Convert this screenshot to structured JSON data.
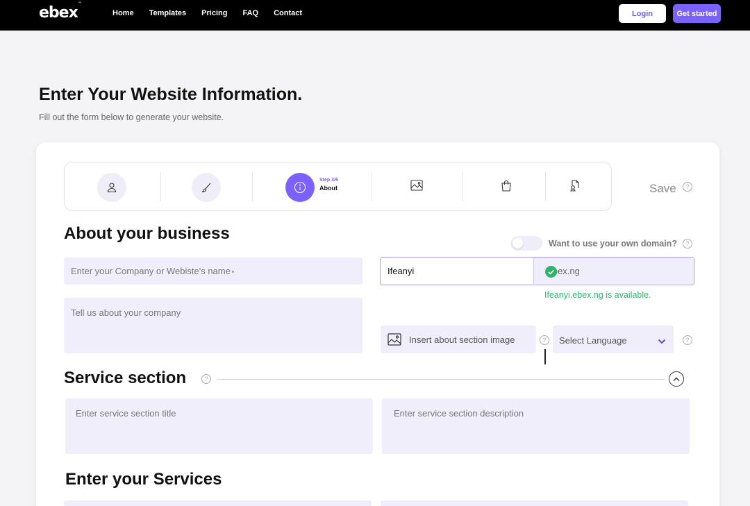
{
  "brand": {
    "name": "ebex",
    "tm": "™"
  },
  "nav": {
    "links": [
      "Home",
      "Templates",
      "Pricing",
      "FAQ",
      "Contact"
    ],
    "login": "Login",
    "get_started": "Get started"
  },
  "header": {
    "title": "Enter Your Website Information.",
    "subtitle": "Fill out the form below  to generate your website."
  },
  "stepper": {
    "step_count": "Step 3/6",
    "step_label": "About",
    "icons": [
      "user-icon",
      "brush-icon",
      "info-icon",
      "image-icon",
      "shopping-bag-icon",
      "document-icon"
    ],
    "save_label": "Save"
  },
  "about": {
    "title": "About your business",
    "domain_question": "Want to use your own domain?",
    "company_placeholder": "Enter your Company or Webiste's name",
    "about_placeholder": "Tell us about your company",
    "domain_value": "Ifeanyi",
    "domain_suffix": ".ebex.ng",
    "availability": "Ifeanyi.ebex.ng is available.",
    "image_label": "Insert about section image",
    "language_label": "Select Language"
  },
  "service": {
    "title": "Service section",
    "title_placeholder": "Enter service section title",
    "desc_placeholder": "Enter service section description"
  },
  "services": {
    "title": "Enter your Services"
  },
  "colors": {
    "accent": "#7b61ff",
    "field_bg": "#f0eefb",
    "success": "#35b572"
  }
}
